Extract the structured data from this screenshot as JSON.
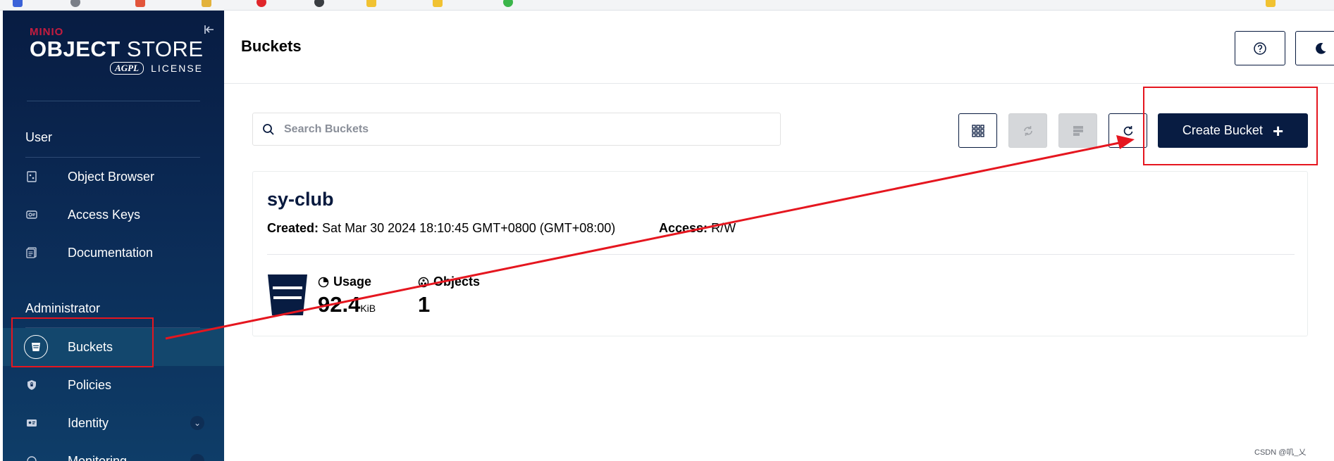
{
  "sidebar": {
    "brand": "MINIO",
    "product_bold": "OBJECT",
    "product_rest": " STORE",
    "license_badge": "AGPL",
    "license_text": "LICENSE",
    "sections": {
      "user": "User",
      "administrator": "Administrator"
    },
    "items": [
      {
        "label": "Object Browser",
        "icon": "object-browser-icon"
      },
      {
        "label": "Access Keys",
        "icon": "access-keys-icon"
      },
      {
        "label": "Documentation",
        "icon": "documentation-icon"
      },
      {
        "label": "Buckets",
        "icon": "bucket-icon",
        "active": true
      },
      {
        "label": "Policies",
        "icon": "shield-icon"
      },
      {
        "label": "Identity",
        "icon": "identity-icon"
      },
      {
        "label": "Monitoring",
        "icon": "monitoring-icon"
      }
    ]
  },
  "header": {
    "title": "Buckets"
  },
  "toolbar": {
    "search_placeholder": "Search Buckets",
    "create_label": "Create Bucket"
  },
  "bucket": {
    "name": "sy-club",
    "created_label": "Created:",
    "created_value": "Sat Mar 30 2024 18:10:45 GMT+0800 (GMT+08:00)",
    "access_label": "Access:",
    "access_value": "R/W",
    "usage_label": "Usage",
    "usage_value": "92.4",
    "usage_unit": "KiB",
    "objects_label": "Objects",
    "objects_value": "1"
  },
  "watermark": "CSDN @叽_乂",
  "colors": {
    "sidebar_bg": "#081c42",
    "accent_dark": "#07193e",
    "annotation_red": "#e5161f",
    "brand_red": "#c51c3f"
  }
}
